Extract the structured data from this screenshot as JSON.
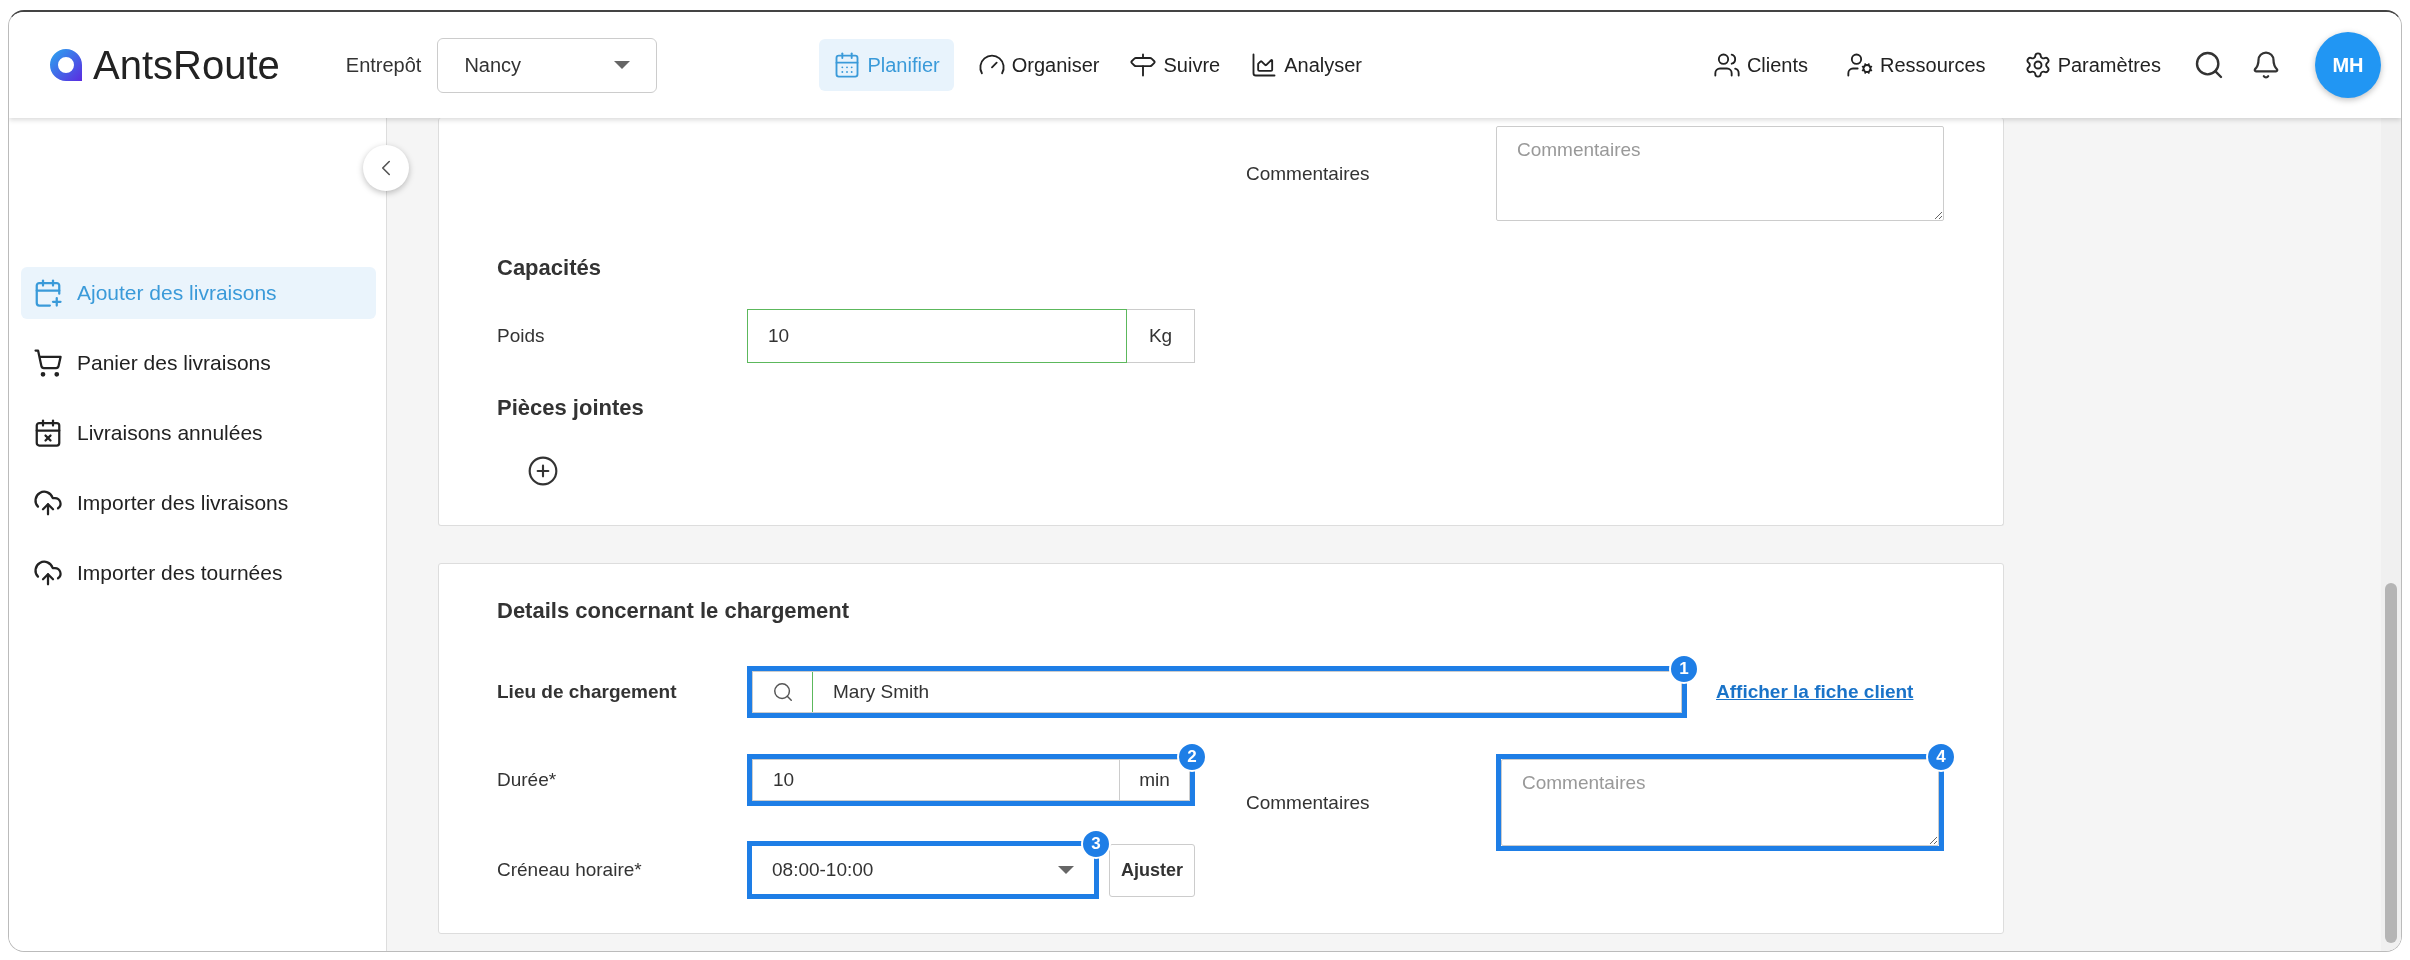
{
  "header": {
    "logo": "**Ants**Route",
    "warehouse": {
      "label": "Entrepôt",
      "value": "Nancy"
    },
    "nav": [
      {
        "label": "Planifier",
        "selected": true
      },
      {
        "label": "Organiser",
        "selected": false
      },
      {
        "label": "Suivre",
        "selected": false
      },
      {
        "label": "Analyser",
        "selected": false
      }
    ],
    "right_nav": [
      {
        "label": "Clients"
      },
      {
        "label": "Ressources"
      },
      {
        "label": "Paramètres"
      }
    ],
    "avatar": "MH"
  },
  "sidebar": {
    "items": [
      {
        "label": "Ajouter des livraisons",
        "selected": true
      },
      {
        "label": "Panier des livraisons",
        "selected": false
      },
      {
        "label": "Livraisons annulées",
        "selected": false
      },
      {
        "label": "Importer des livraisons",
        "selected": false
      },
      {
        "label": "Importer des tournées",
        "selected": false
      }
    ]
  },
  "details_card": {
    "comment_field": {
      "label": "Commentaires",
      "placeholder": "Commentaires"
    },
    "capacities": {
      "title": "Capacités",
      "rows": [
        {
          "label": "Poids",
          "value": "10",
          "unit": "Kg",
          "valid": true
        }
      ]
    },
    "attachments": {
      "title": "Pièces jointes"
    }
  },
  "loading_card": {
    "title": "Details concernant le chargement",
    "location": {
      "label": "Lieu de chargement",
      "value": "Mary Smith",
      "callout": "1",
      "link": "Afficher la fiche client"
    },
    "duration": {
      "label": "Durée*",
      "value": "10",
      "unit": "min",
      "callout": "2"
    },
    "time_slot": {
      "label": "Créneau horaire*",
      "value": "08:00-10:00",
      "callout": "3",
      "button": "Ajuster"
    },
    "comment_field": {
      "label": "Commentaires",
      "placeholder": "Commentaires",
      "callout": "4"
    }
  }
}
